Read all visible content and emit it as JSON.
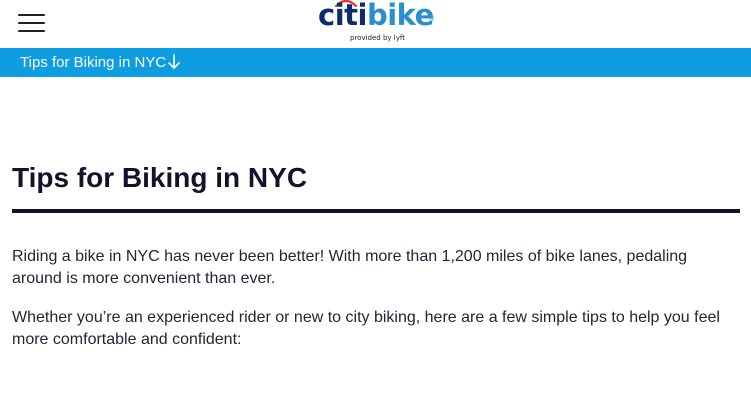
{
  "header": {
    "menu_icon": "hamburger-menu-icon",
    "logo": {
      "citi": "citi",
      "bike": "bike",
      "registered": "®",
      "tagline": "provided by lyft"
    }
  },
  "subnav": {
    "label": "Tips for Biking in NYC",
    "icon": "arrow-down-icon"
  },
  "article": {
    "title": "Tips for Biking in NYC",
    "paragraphs": [
      "Riding a bike in NYC has never been better! With more than 1,200 miles of bike lanes, pedaling around is more convenient than ever.",
      "Whether you’re an experienced rider or new to city biking, here are a few simple tips to help you feel more comfortable and confident:"
    ]
  },
  "colors": {
    "subnav_background": "#0e9de0",
    "brand_navy": "#0e2c6b",
    "brand_blue": "#2a8fd0",
    "arc_red": "#e4322b",
    "text_dark": "#12122a"
  }
}
